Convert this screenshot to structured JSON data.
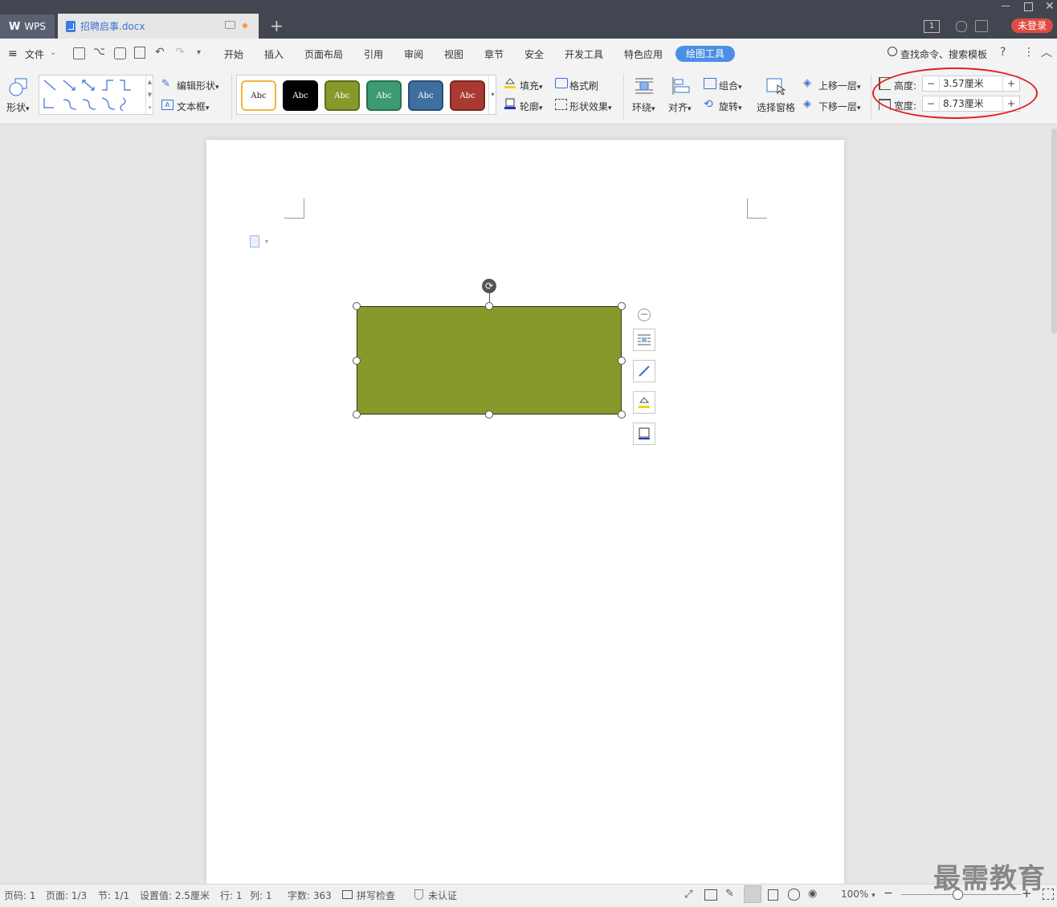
{
  "app": {
    "name": "WPS",
    "login_label": "未登录",
    "badge": "1"
  },
  "tabs": [
    {
      "title": "招聘启事.docx"
    }
  ],
  "menu": {
    "file": "文件",
    "items": [
      "开始",
      "插入",
      "页面布局",
      "引用",
      "审阅",
      "视图",
      "章节",
      "安全",
      "开发工具",
      "特色应用"
    ],
    "active": "绘图工具",
    "search": "查找命令、搜索模板",
    "help": "?"
  },
  "ribbon": {
    "shape_label": "形状",
    "edit_shape": "编辑形状",
    "text_box": "文本框",
    "style_text": "Abc",
    "styles": [
      {
        "color": "#ffffff",
        "border": "#f0b43c",
        "text_color": "#222222"
      },
      {
        "color": "#000000",
        "border": "#000000",
        "text_color": "#ffffff"
      },
      {
        "color": "#86992b",
        "border": "#5d6d1a",
        "text_color": "#ffffff",
        "selected": true
      },
      {
        "color": "#3d9a72",
        "border": "#2a6e50",
        "text_color": "#ffffff"
      },
      {
        "color": "#3f6f9e",
        "border": "#2b4f72",
        "text_color": "#ffffff"
      },
      {
        "color": "#a83a32",
        "border": "#7a2822",
        "text_color": "#ffffff"
      }
    ],
    "fill": "填充",
    "format_painter": "格式刷",
    "outline": "轮廓",
    "shape_effect": "形状效果",
    "wrap": "环绕",
    "align": "对齐",
    "group": "组合",
    "rotate": "旋转",
    "select_pane": "选择窗格",
    "bring_forward": "上移一层",
    "send_backward": "下移一层",
    "height_label": "高度:",
    "height_value": "3.57厘米",
    "width_label": "宽度:",
    "width_value": "8.73厘米"
  },
  "document": {
    "shape_fill": "#86992b"
  },
  "status": {
    "page_code": "页码: 1",
    "pages": "页面: 1/3",
    "section": "节: 1/1",
    "setting": "设置值: 2.5厘米",
    "row": "行: 1",
    "col": "列: 1",
    "words": "字数: 363",
    "spell": "拼写检查",
    "cert": "未认证",
    "zoom": "100%"
  },
  "watermark": "最需教育"
}
